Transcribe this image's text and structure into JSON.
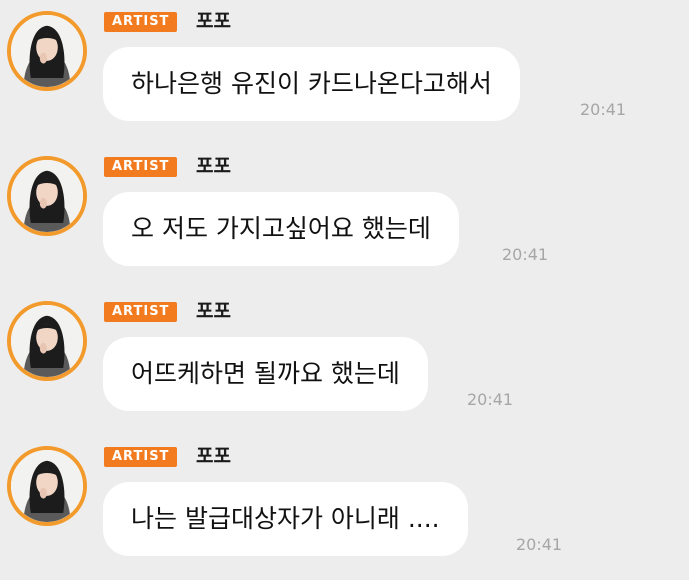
{
  "colors": {
    "background": "#ededed",
    "badge": "#f37b1f",
    "avatar_ring": "#f39a2c",
    "bubble": "#ffffff",
    "time": "#a6a6a6"
  },
  "messages": [
    {
      "badge": "ARTIST",
      "sender": "포포",
      "text": "하나은행 유진이 카드나온다고해서",
      "time": "20:41"
    },
    {
      "badge": "ARTIST",
      "sender": "포포",
      "text": "오 저도 가지고싶어요 했는데",
      "time": "20:41"
    },
    {
      "badge": "ARTIST",
      "sender": "포포",
      "text": "어뜨케하면 될까요 했는데",
      "time": "20:41"
    },
    {
      "badge": "ARTIST",
      "sender": "포포",
      "text": "나는 발급대상자가 아니래 ....",
      "time": "20:41"
    }
  ]
}
